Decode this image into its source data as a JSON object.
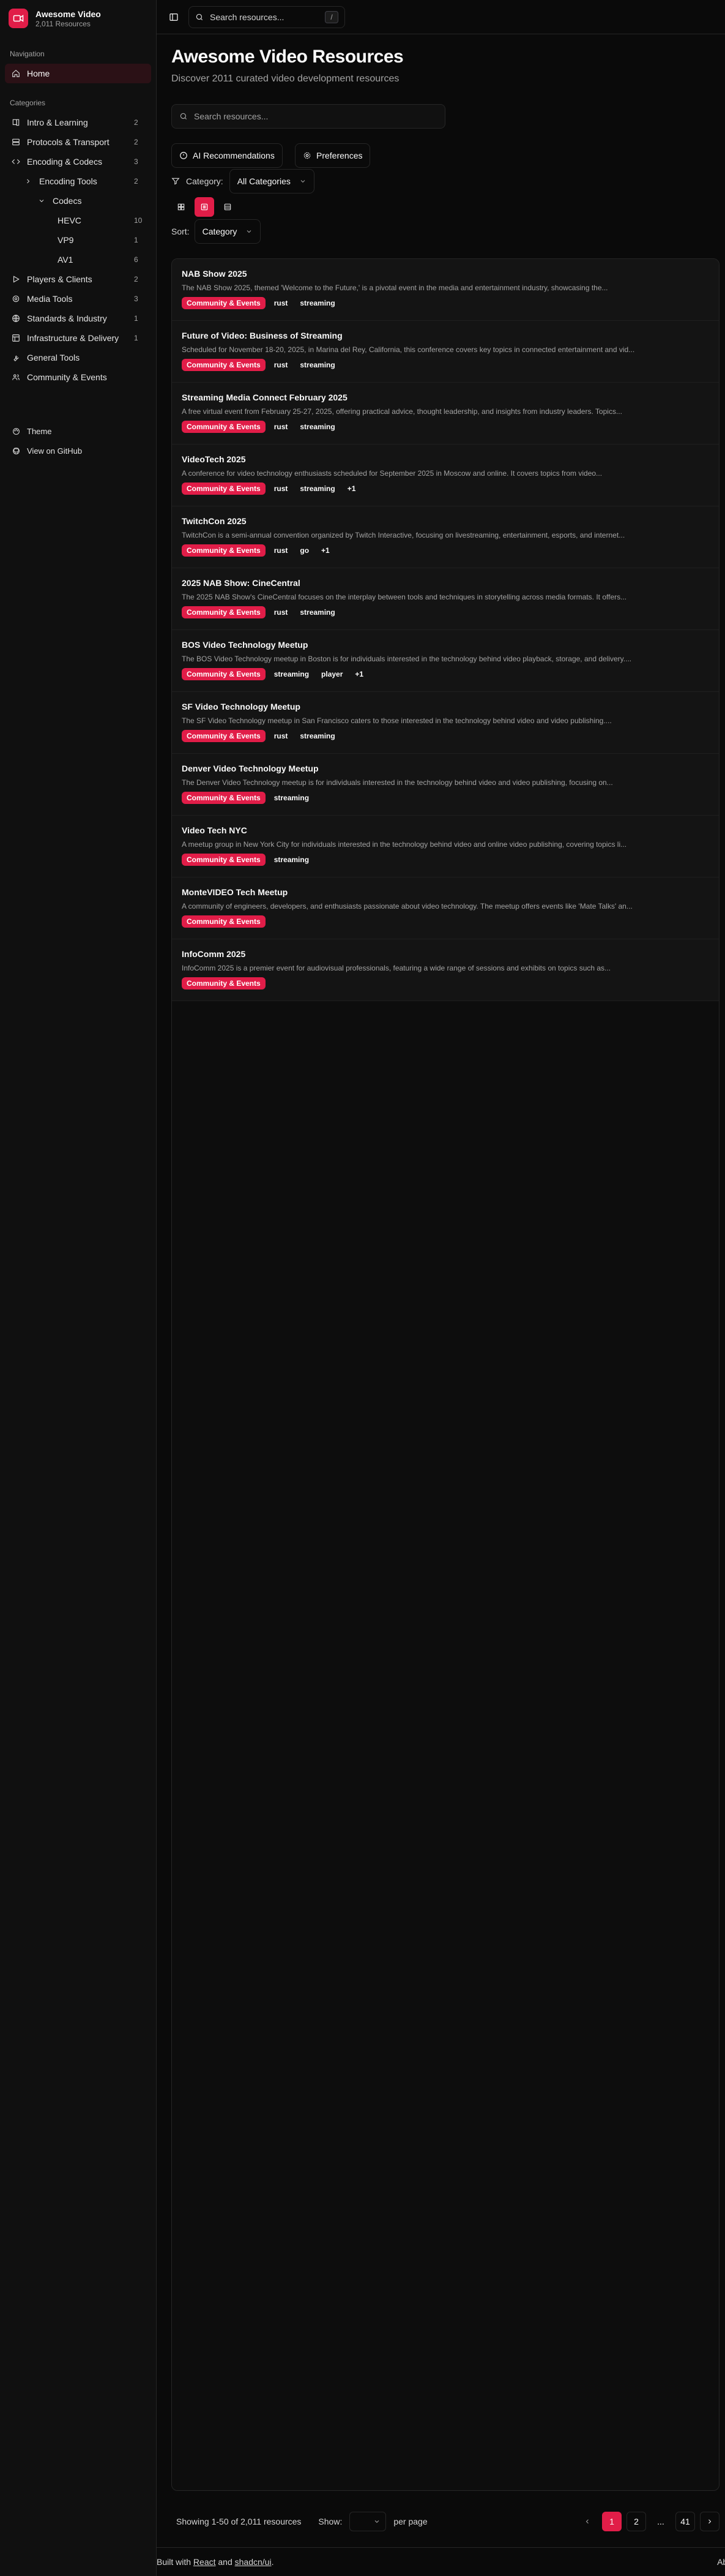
{
  "brand": {
    "title": "Awesome Video",
    "subtitle": "2,011 Resources"
  },
  "sidebar": {
    "nav_label": "Navigation",
    "home": "Home",
    "categories_label": "Categories",
    "categories": [
      {
        "label": "Intro & Learning",
        "count": "2"
      },
      {
        "label": "Protocols & Transport",
        "count": "2"
      },
      {
        "label": "Encoding & Codecs",
        "count": "3"
      },
      {
        "label": "Encoding Tools",
        "count": "2"
      },
      {
        "label": "Codecs",
        "count": ""
      },
      {
        "label": "HEVC",
        "count": "10"
      },
      {
        "label": "VP9",
        "count": "1"
      },
      {
        "label": "AV1",
        "count": "6"
      },
      {
        "label": "Players & Clients",
        "count": "2"
      },
      {
        "label": "Media Tools",
        "count": "3"
      },
      {
        "label": "Standards & Industry",
        "count": "1"
      },
      {
        "label": "Infrastructure & Delivery",
        "count": "1"
      },
      {
        "label": "General Tools",
        "count": ""
      },
      {
        "label": "Community & Events",
        "count": ""
      }
    ],
    "theme": "Theme",
    "github": "View on GitHub"
  },
  "topbar": {
    "search_placeholder": "Search resources...",
    "shortcut": "/"
  },
  "page": {
    "title": "Awesome Video Resources",
    "subtitle": "Discover 2011 curated video development resources",
    "search_placeholder": "Search resources...",
    "ai_button": "AI Recommendations",
    "prefs_button": "Preferences",
    "category_label": "Category:",
    "category_value": "All Categories",
    "sort_label": "Sort:",
    "sort_value": "Category"
  },
  "resources": [
    {
      "title": "NAB Show 2025",
      "desc": "The NAB Show 2025, themed 'Welcome to the Future,' is a pivotal event in the media and entertainment industry, showcasing the...",
      "category": "Community & Events",
      "tags": [
        "rust",
        "streaming"
      ]
    },
    {
      "title": "Future of Video: Business of Streaming",
      "desc": "Scheduled for November 18-20, 2025, in Marina del Rey, California, this conference covers key topics in connected entertainment and vid...",
      "category": "Community & Events",
      "tags": [
        "rust",
        "streaming"
      ]
    },
    {
      "title": "Streaming Media Connect February 2025",
      "desc": "A free virtual event from February 25-27, 2025, offering practical advice, thought leadership, and insights from industry leaders. Topics...",
      "category": "Community & Events",
      "tags": [
        "rust",
        "streaming"
      ]
    },
    {
      "title": "VideoTech 2025",
      "desc": "A conference for video technology enthusiasts scheduled for September 2025 in Moscow and online. It covers topics from video...",
      "category": "Community & Events",
      "tags": [
        "rust",
        "streaming",
        "+1"
      ]
    },
    {
      "title": "TwitchCon 2025",
      "desc": "TwitchCon is a semi-annual convention organized by Twitch Interactive, focusing on livestreaming, entertainment, esports, and internet...",
      "category": "Community & Events",
      "tags": [
        "rust",
        "go",
        "+1"
      ]
    },
    {
      "title": "2025 NAB Show: CineCentral",
      "desc": "The 2025 NAB Show's CineCentral focuses on the interplay between tools and techniques in storytelling across media formats. It offers...",
      "category": "Community & Events",
      "tags": [
        "rust",
        "streaming"
      ]
    },
    {
      "title": "BOS Video Technology Meetup",
      "desc": "The BOS Video Technology meetup in Boston is for individuals interested in the technology behind video playback, storage, and delivery....",
      "category": "Community & Events",
      "tags": [
        "streaming",
        "player",
        "+1"
      ]
    },
    {
      "title": "SF Video Technology Meetup",
      "desc": "The SF Video Technology meetup in San Francisco caters to those interested in the technology behind video and video publishing....",
      "category": "Community & Events",
      "tags": [
        "rust",
        "streaming"
      ]
    },
    {
      "title": "Denver Video Technology Meetup",
      "desc": "The Denver Video Technology meetup is for individuals interested in the technology behind video and video publishing, focusing on...",
      "category": "Community & Events",
      "tags": [
        "streaming"
      ]
    },
    {
      "title": "Video Tech NYC",
      "desc": "A meetup group in New York City for individuals interested in the technology behind video and online video publishing, covering topics li...",
      "category": "Community & Events",
      "tags": [
        "streaming"
      ]
    },
    {
      "title": "MonteVIDEO Tech Meetup",
      "desc": "A community of engineers, developers, and enthusiasts passionate about video technology. The meetup offers events like 'Mate Talks' an...",
      "category": "Community & Events",
      "tags": []
    },
    {
      "title": "InfoComm 2025",
      "desc": "InfoComm 2025 is a premier event for audiovisual professionals, featuring a wide range of sessions and exhibits on topics such as...",
      "category": "Community & Events",
      "tags": []
    }
  ],
  "pagination": {
    "showing": "Showing 1-50 of 2,011 resources",
    "show_label": "Show:",
    "per_page_label": "per page",
    "pages": [
      "1",
      "2",
      "...",
      "41"
    ],
    "current": "1"
  },
  "footer": {
    "built_prefix": "Built with ",
    "react": "React",
    "and": " and ",
    "shadcn": "shadcn/ui",
    "period": ".",
    "right": "Abo"
  },
  "colors": {
    "accent": "#e11d48",
    "background": "#0a0a0a",
    "sidebar": "#101010",
    "card": "#141414"
  }
}
